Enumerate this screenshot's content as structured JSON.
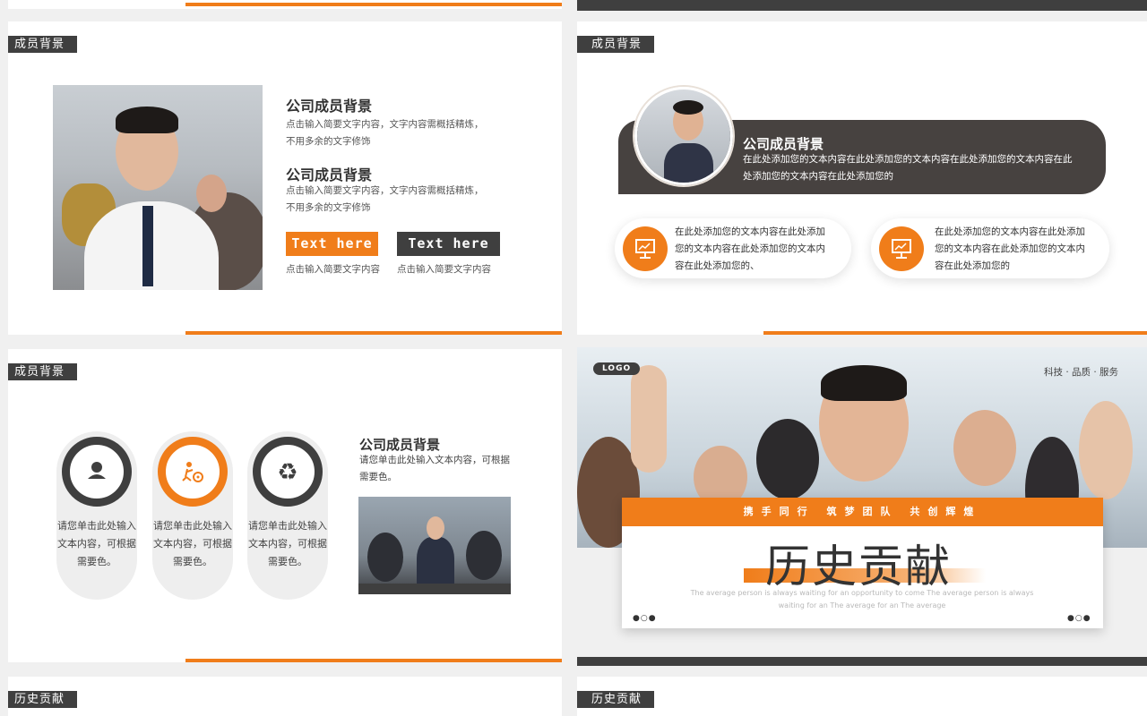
{
  "colors": {
    "accent": "#f07d1a",
    "dark": "#3f3f3f"
  },
  "slide_a": {
    "tag": "成员背景",
    "sections": [
      {
        "title": "公司成员背景",
        "desc": "点击输入简要文字内容，文字内容需概括精炼，不用多余的文字修饰"
      },
      {
        "title": "公司成员背景",
        "desc": "点击输入简要文字内容，文字内容需概括精炼，不用多余的文字修饰"
      }
    ],
    "buttons": [
      {
        "label": "Text here",
        "sub": "点击输入简要文字内容"
      },
      {
        "label": "Text here",
        "sub": "点击输入简要文字内容"
      }
    ]
  },
  "slide_b": {
    "tag": "成员背景",
    "bar_title": "公司成员背景",
    "bar_text": "在此处添加您的文本内容在此处添加您的文本内容在此处添加您的文本内容在此处添加您的文本内容在此处添加您的",
    "pills": [
      {
        "icon": "presentation-icon",
        "text": "在此处添加您的文本内容在此处添加您的文本内容在此处添加您的文本内容在此处添加您的、"
      },
      {
        "icon": "presentation-icon",
        "text": "在此处添加您的文本内容在此处添加您的文本内容在此处添加您的文本内容在此处添加您的"
      }
    ]
  },
  "slide_c": {
    "tag": "成员背景",
    "capsules": [
      {
        "icon": "person-icon",
        "text": "请您单击此处输入文本内容，可根据需要色。"
      },
      {
        "icon": "teamwork-gear-icon",
        "text": "请您单击此处输入文本内容，可根据需要色。"
      },
      {
        "icon": "recycle-icon",
        "text": "请您单击此处输入文本内容，可根据需要色。"
      }
    ],
    "title": "公司成员背景",
    "desc": "请您单击此处输入文本内容，可根据需要色。"
  },
  "slide_d": {
    "logo": "LOGO",
    "nav": "科技 · 品质 · 服务",
    "band": "携手同行 筑梦团队 共创辉煌",
    "title": "历史贡献",
    "sub": "The average person is always waiting for an opportunity to come The average person is always waiting for an The average for an The average",
    "dots": "●○●"
  },
  "slide_e": {
    "tag": "历史贡献"
  },
  "slide_f": {
    "tag": "历史贡献"
  }
}
